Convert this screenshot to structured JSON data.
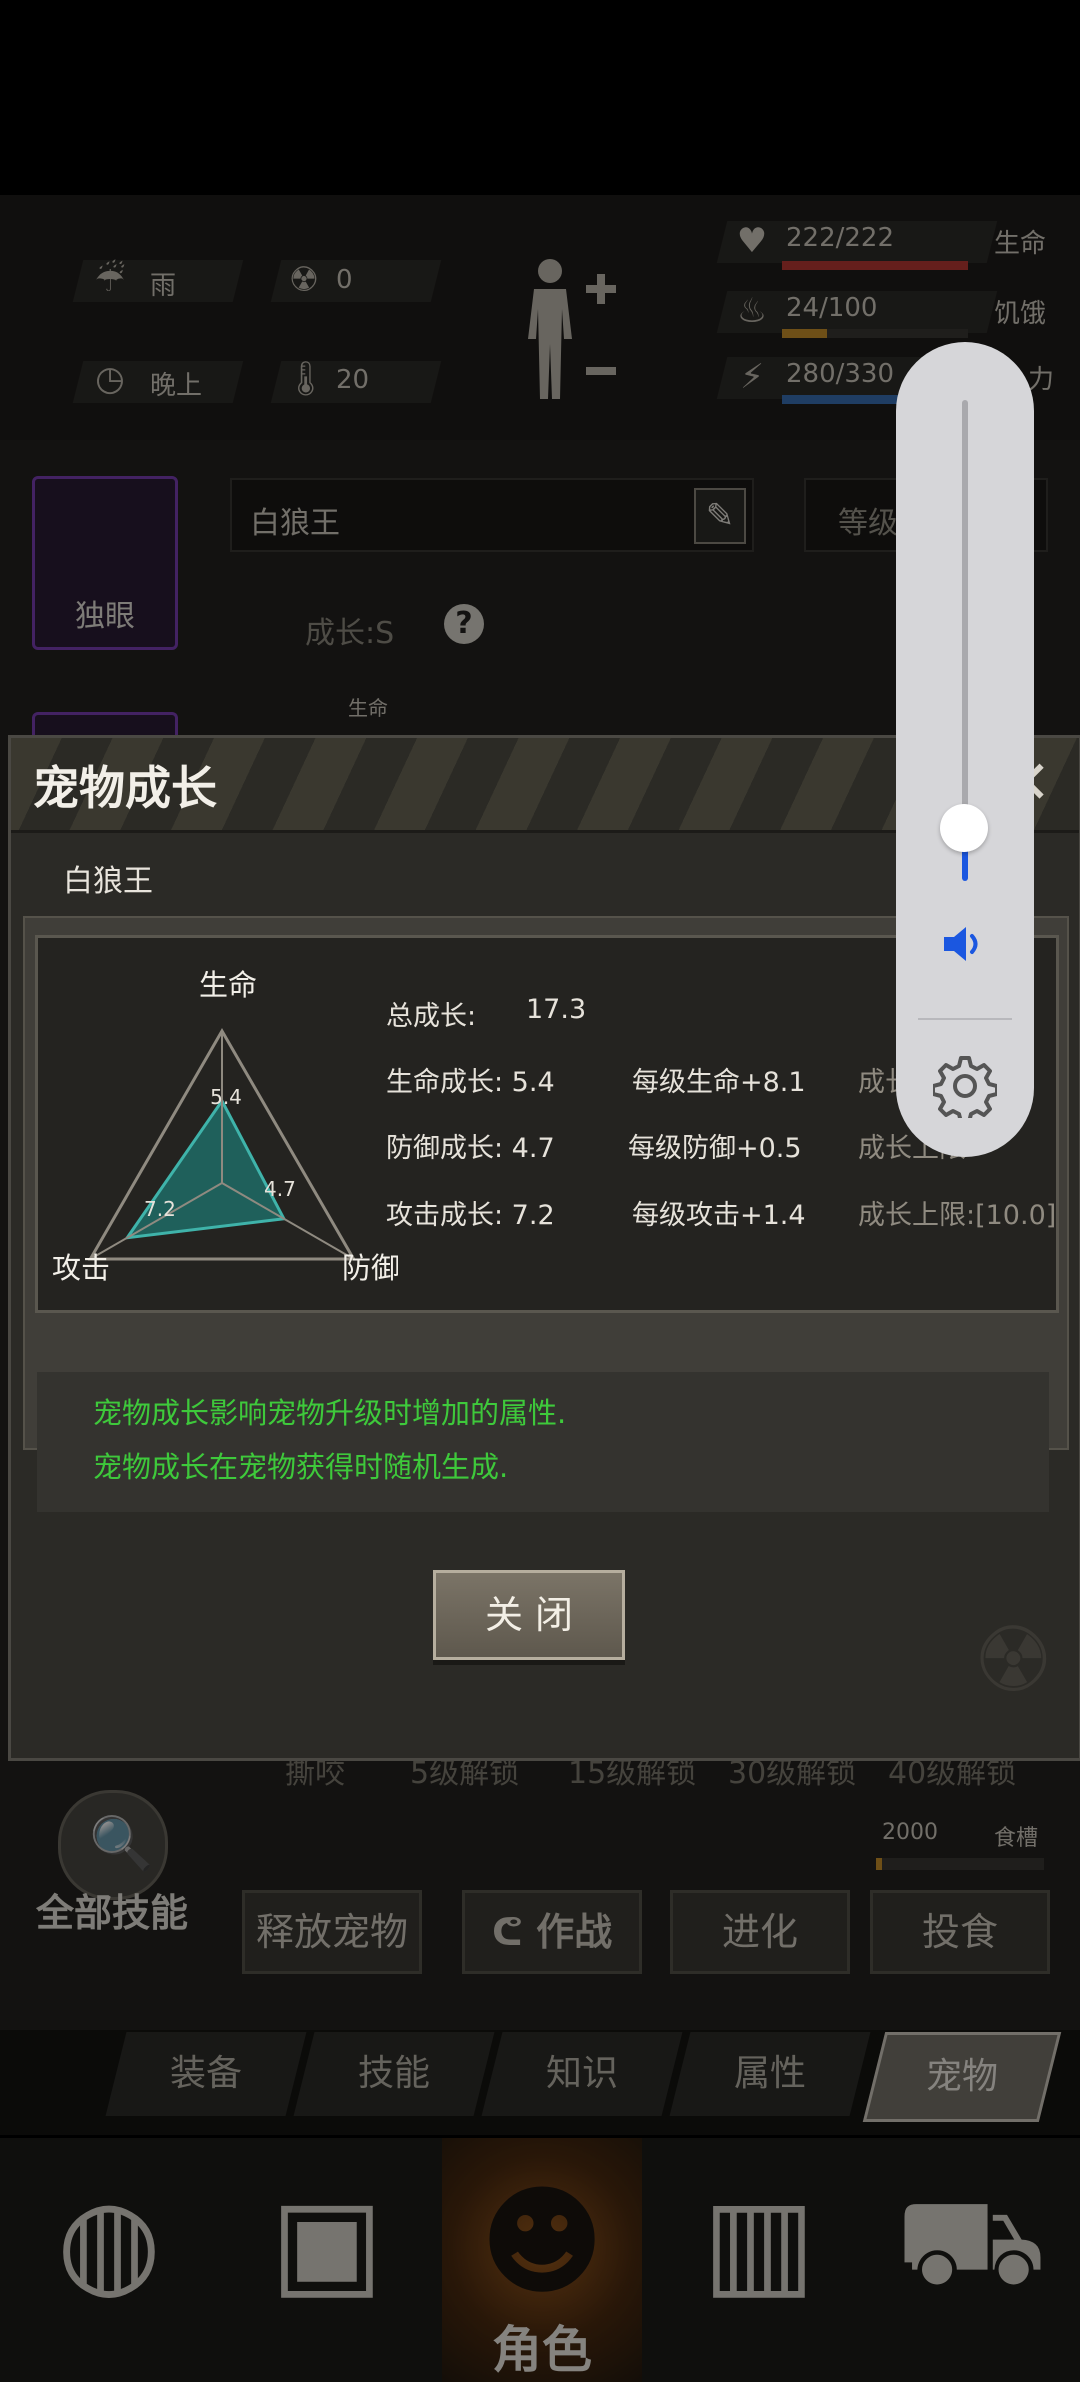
{
  "hud": {
    "weather": "雨",
    "radiation": "0",
    "time_of_day": "晚上",
    "temperature": "20",
    "life_value": "222/222",
    "life_label": "生命",
    "hunger_value": "24/100",
    "hunger_label": "饥饿",
    "energy_value": "280/330",
    "energy_label": "力",
    "life_fraction": 1.0,
    "hunger_fraction": 0.24,
    "energy_fraction": 0.85,
    "colors": {
      "life": "#b93a33",
      "hunger": "#c8902a",
      "energy": "#3a6fb5"
    }
  },
  "pet_panel": {
    "pet_slot_label": "独眼",
    "name_field": "白狼王",
    "level_label": "等级",
    "growth_label": "成长:S",
    "small_label": "生命",
    "unlock_row": [
      "撕咬",
      "5级解锁",
      "15级解锁",
      "30级解锁",
      "40级解锁"
    ],
    "food_value": "2000",
    "food_label": "食槽",
    "all_skills_label": "全部技能",
    "buttons": [
      "释放宠物",
      "作战",
      "进化",
      "投食"
    ]
  },
  "sub_tabs": [
    "装备",
    "技能",
    "知识",
    "属性",
    "宠物"
  ],
  "nav": {
    "active_label": "角色",
    "icons": [
      "globe-icon",
      "backpack-icon",
      "character-icon",
      "walkie-talkie-icon",
      "cart-icon"
    ]
  },
  "dialog": {
    "title": "宠物成长",
    "pet_name": "白狼王",
    "radar": {
      "top_label": "生命",
      "left_label": "攻击",
      "right_label": "防御",
      "life_value_text": "5.4",
      "defense_value_text": "4.7",
      "attack_value_text": "7.2"
    },
    "stats": {
      "total_label": "总成长:",
      "total_value": "17.3",
      "rows": [
        {
          "growth": "生命成长: 5.4",
          "per_level": "每级生命+8.1",
          "limit": "成长"
        },
        {
          "growth": "防御成长: 4.7",
          "per_level": "每级防御+0.5",
          "limit": "成长上限"
        },
        {
          "growth": "攻击成长: 7.2",
          "per_level": "每级攻击+1.4",
          "limit": "成长上限:[10.0]"
        }
      ]
    },
    "info_lines": [
      "宠物成长影响宠物升级时增加的属性.",
      "宠物成长在宠物获得时随机生成."
    ],
    "close_button": "关 闭"
  },
  "chart_data": {
    "type": "radar",
    "axes": [
      "生命",
      "防御",
      "攻击"
    ],
    "values": [
      5.4,
      4.7,
      7.2
    ],
    "max": 10.0
  },
  "volume": {
    "level": 0.1,
    "accent": "#1b57e0"
  }
}
